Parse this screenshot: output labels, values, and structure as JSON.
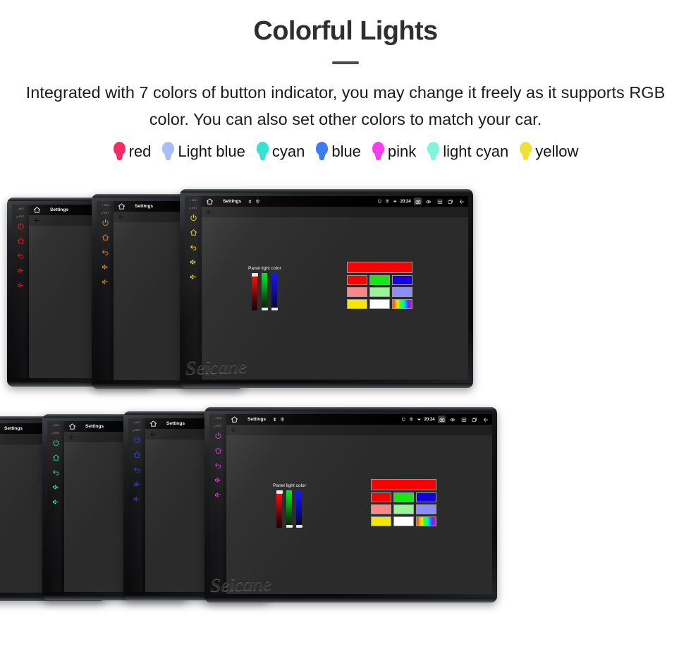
{
  "header": {
    "title": "Colorful Lights",
    "subtitle": "Integrated with 7 colors of button indicator, you may change it freely as it supports RGB color. You can also set other colors to match your car."
  },
  "legend": {
    "items": [
      {
        "label": "red",
        "color": "#fa2a64",
        "icon": "bulb-icon"
      },
      {
        "label": "Light blue",
        "color": "#a8bdfa",
        "icon": "bulb-icon"
      },
      {
        "label": "cyan",
        "color": "#35e3d2",
        "icon": "bulb-icon"
      },
      {
        "label": "blue",
        "color": "#3b7df0",
        "icon": "bulb-icon"
      },
      {
        "label": "pink",
        "color": "#fa3df0",
        "icon": "bulb-icon"
      },
      {
        "label": "light cyan",
        "color": "#82f5dc",
        "icon": "bulb-icon"
      },
      {
        "label": "yellow",
        "color": "#f0e03a",
        "icon": "bulb-icon"
      }
    ]
  },
  "device": {
    "status_bar": {
      "home_icon": "home-icon",
      "title": "Settings",
      "mini_icons": [
        "bluetooth-icon",
        "location-pin-icon"
      ],
      "tray_icons": [
        "shield-icon",
        "location-pin-icon",
        "wifi-icon"
      ],
      "clock": "20:24",
      "buttons": [
        {
          "icon": "camera-icon",
          "active": true
        },
        {
          "icon": "volume-icon",
          "active": false
        },
        {
          "icon": "close-box-icon",
          "active": false
        },
        {
          "icon": "recents-icon",
          "active": false
        },
        {
          "icon": "back-arrow-icon",
          "active": false
        }
      ]
    },
    "action_bar": {
      "back_icon": "back-arrow-icon"
    },
    "key_strip": {
      "mic_label": "MIC",
      "rst_label": "RST",
      "keys": [
        "power-icon",
        "home-icon",
        "back-icon",
        "volume-up-icon",
        "volume-down-icon"
      ]
    },
    "panel_light": {
      "label": "Panel light color",
      "sliders": [
        {
          "channel": "R",
          "value": 255,
          "thumb": "top"
        },
        {
          "channel": "G",
          "value": 0,
          "thumb": "bottom"
        },
        {
          "channel": "B",
          "value": 0,
          "thumb": "bottom"
        }
      ],
      "preview_color": "#fa0000",
      "swatches": [
        [
          "#fa0000",
          "#12e812",
          "#1400e0"
        ],
        [
          "#fa8888",
          "#96f596",
          "#8c8cfa"
        ],
        [
          "#f5e800",
          "#ffffff",
          "rainbow"
        ]
      ]
    }
  },
  "watermark": "Seicane",
  "units": {
    "top_row": [
      {
        "name": "unit-red",
        "button_color": "#e01414"
      },
      {
        "name": "unit-orange",
        "button_color": "#f08000"
      },
      {
        "name": "unit-yellow",
        "button_color": "#f0e000"
      }
    ],
    "bottom_row": [
      {
        "name": "unit-green",
        "button_color": "#14e020"
      },
      {
        "name": "unit-spring",
        "button_color": "#14e090"
      },
      {
        "name": "unit-blue",
        "button_color": "#2a32f0"
      },
      {
        "name": "unit-magenta",
        "button_color": "#e81ce0"
      }
    ]
  }
}
